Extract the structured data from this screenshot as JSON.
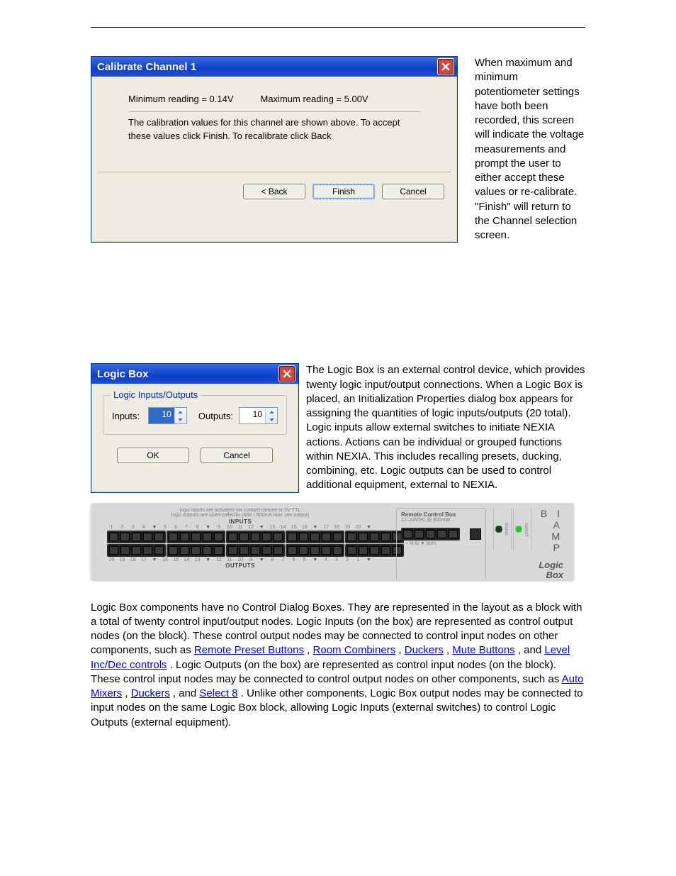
{
  "dialog1": {
    "title": "Calibrate Channel 1",
    "min_reading": "Minimum reading = 0.14V",
    "max_reading": "Maximum reading = 5.00V",
    "instruction": "The calibration values for this channel are shown above. To accept these values click Finish.  To recalibrate click Back",
    "back": "< Back",
    "finish": "Finish",
    "cancel": "Cancel"
  },
  "paragraph1": "When maximum and minimum potentiometer settings have both been recorded, this screen will indicate the voltage measurements and prompt the user to either accept these values or re-calibrate. \"Finish\" will return to the Channel selection screen.",
  "dialog2": {
    "title": "Logic Box",
    "group": "Logic Inputs/Outputs",
    "inputs_label": "Inputs:",
    "inputs_value": "10",
    "outputs_label": "Outputs:",
    "outputs_value": "10",
    "ok": "OK",
    "cancel": "Cancel"
  },
  "paragraph2": "The Logic Box is an external control device, which provides twenty logic input/output connections. When a Logic Box is placed, an Initialization Properties dialog box appears for assigning the quantities of logic inputs/outputs (20 total). Logic inputs allow external switches to initiate NEXIA actions. Actions can be individual or grouped functions within NEXIA. This includes recalling presets, ducking, combining, etc. Logic outputs can be used to control additional equipment, external to NEXIA.",
  "hardware": {
    "note1": "logic inputs are activated via contact-closure or 5V TTL",
    "note2": "logic outputs are open-collector (40V / 500mA max. per output)",
    "inputs_label": "INPUTS",
    "outputs_label": "OUTPUTS",
    "nums_top": [
      "1",
      "2",
      "3",
      "4",
      "▼",
      "5",
      "6",
      "7",
      "8",
      "▼",
      "9",
      "10",
      "11",
      "12",
      "▼",
      "13",
      "14",
      "15",
      "16",
      "▼",
      "17",
      "18",
      "19",
      "20",
      "▼"
    ],
    "nums_bot": [
      "20",
      "19",
      "18",
      "17",
      "▼",
      "16",
      "15",
      "14",
      "13",
      "▼",
      "12",
      "11",
      "10",
      "9",
      "▼",
      "8",
      "7",
      "6",
      "5",
      "▼",
      "4",
      "3",
      "2",
      "1",
      "▼"
    ],
    "rcb_title": "Remote Control Bus",
    "rcb_sub": "12–24VDC @ 600mW",
    "rcb_labels": "+   −   hi  lo  ▼         term",
    "status": "status",
    "power": "power",
    "brand": "B I A M P",
    "logicbox1": "Logic",
    "logicbox2": "Box"
  },
  "paragraph3": {
    "t1": "Logic Box components have no Control Dialog Boxes. They are represented in the layout as a block with a total of twenty control input/output nodes. Logic Inputs (on the box) are represented as control output nodes (on the block). These control output nodes may be connected to control input nodes on other components, such as ",
    "link_rpb": "Remote Preset Buttons",
    "t2": ", ",
    "link_rc": "Room Combiners",
    "t3": ", ",
    "link_duck": "Duckers",
    "t4": ", ",
    "link_mute": "Mute Buttons",
    "t5": ", and ",
    "link_lvl": "Level Inc/Dec controls",
    "t6": ". Logic Outputs (on the box) are represented as control input nodes (on the block). These control input nodes may be connected to control output nodes on other components, such as ",
    "link_am": "Auto Mixers",
    "t7": ", ",
    "link_duck2": "Duckers",
    "t8": ", and ",
    "link_sel": "Select 8",
    "t9": ". Unlike other components, Logic Box output nodes may be connected to input nodes on the same Logic Box block, allowing Logic Inputs (external switches) to control Logic Outputs (external equipment)."
  }
}
